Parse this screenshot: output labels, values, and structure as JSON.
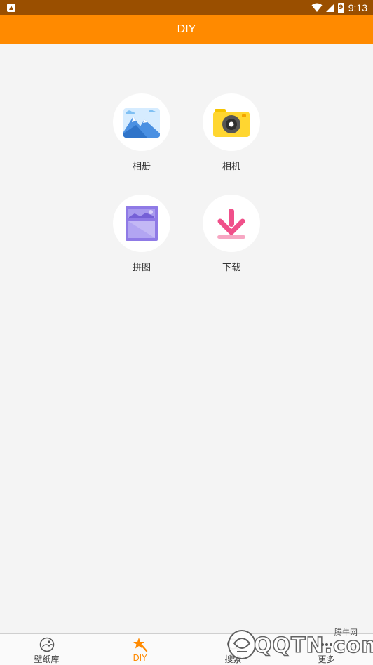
{
  "status_bar": {
    "time": "9:13",
    "battery_level": "9"
  },
  "app_bar": {
    "title": "DIY"
  },
  "grid": [
    {
      "label": "相册",
      "icon": "album-mountain-icon"
    },
    {
      "label": "相机",
      "icon": "camera-icon"
    },
    {
      "label": "拼图",
      "icon": "collage-icon"
    },
    {
      "label": "下载",
      "icon": "download-icon"
    }
  ],
  "bottom_nav": [
    {
      "label": "壁纸库",
      "icon": "wallpaper-icon",
      "active": false
    },
    {
      "label": "DIY",
      "icon": "diy-star-icon",
      "active": true
    },
    {
      "label": "搜索",
      "icon": "search-icon",
      "active": false
    },
    {
      "label": "更多",
      "icon": "more-icon",
      "active": false
    }
  ],
  "watermark": {
    "brand": "QQTN.com",
    "small": "腾牛网"
  },
  "colors": {
    "accent": "#ff8a00",
    "status_bar": "#9a4f00",
    "background": "#f4f4f4"
  }
}
